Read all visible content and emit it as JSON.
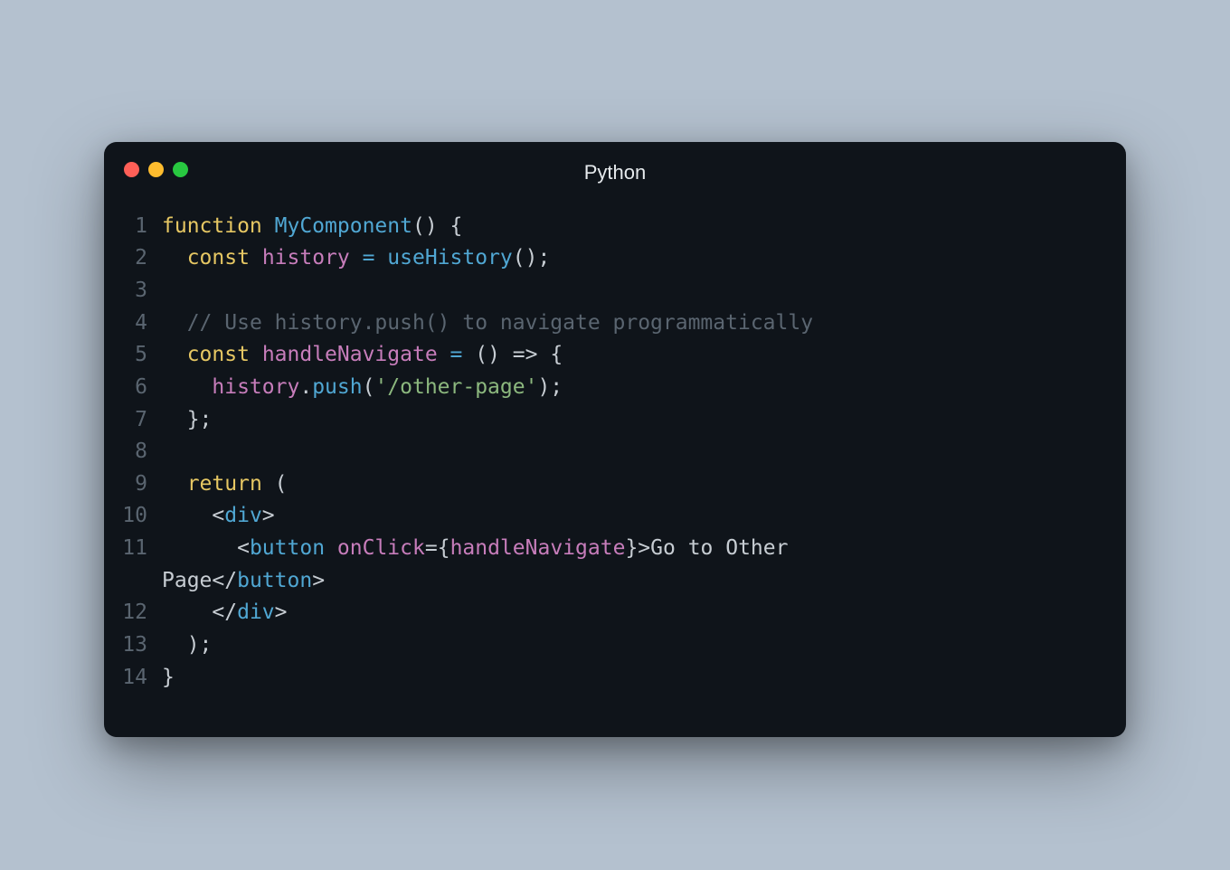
{
  "window": {
    "title": "Python"
  },
  "code": {
    "lines": [
      {
        "n": "1",
        "kind": "l1"
      },
      {
        "n": "2",
        "kind": "l2"
      },
      {
        "n": "3",
        "kind": "blank"
      },
      {
        "n": "4",
        "kind": "l4"
      },
      {
        "n": "5",
        "kind": "l5"
      },
      {
        "n": "6",
        "kind": "l6"
      },
      {
        "n": "7",
        "kind": "l7"
      },
      {
        "n": "8",
        "kind": "blank"
      },
      {
        "n": "9",
        "kind": "l9"
      },
      {
        "n": "10",
        "kind": "l10"
      },
      {
        "n": "11",
        "kind": "l11"
      },
      {
        "n": "12",
        "kind": "l12"
      },
      {
        "n": "13",
        "kind": "l13"
      },
      {
        "n": "14",
        "kind": "l14"
      }
    ],
    "tokens": {
      "l1_function": "function",
      "l1_name": "MyComponent",
      "l1_rest": "() {",
      "l2_indent": "  ",
      "l2_const": "const",
      "l2_sp": " ",
      "l2_history": "history",
      "l2_eq": " = ",
      "l2_use": "useHistory",
      "l2_tail": "();",
      "l4_indent": "  ",
      "l4_cm": "// Use history.push() to navigate programmatically",
      "l5_indent": "  ",
      "l5_const": "const",
      "l5_name": "handleNavigate",
      "l5_eq": " = ",
      "l5_arrow": "() => {",
      "l6_indent": "    ",
      "l6_hist": "history",
      "l6_dot": ".",
      "l6_push": "push",
      "l6_open": "(",
      "l6_str": "'/other-page'",
      "l6_close": ");",
      "l7_indent": "  ",
      "l7_txt": "};",
      "l9_indent": "  ",
      "l9_return": "return",
      "l9_tail": " (",
      "l10_indent": "    ",
      "l10_lt": "<",
      "l10_div": "div",
      "l10_gt": ">",
      "l11_indent": "      ",
      "l11_lt": "<",
      "l11_button": "button",
      "l11_sp": " ",
      "l11_onclick": "onClick",
      "l11_eq2": "=",
      "l11_lb": "{",
      "l11_hn": "handleNavigate",
      "l11_rb": "}",
      "l11_gt": ">",
      "l11_text1": "Go to Other ",
      "l11_text2": "Page",
      "l11_clt": "</",
      "l11_cbutton": "button",
      "l11_cgt": ">",
      "l12_indent": "    ",
      "l12_clt": "</",
      "l12_div": "div",
      "l12_cgt": ">",
      "l13_indent": "  ",
      "l13_txt": ");",
      "l14_txt": "}"
    }
  }
}
